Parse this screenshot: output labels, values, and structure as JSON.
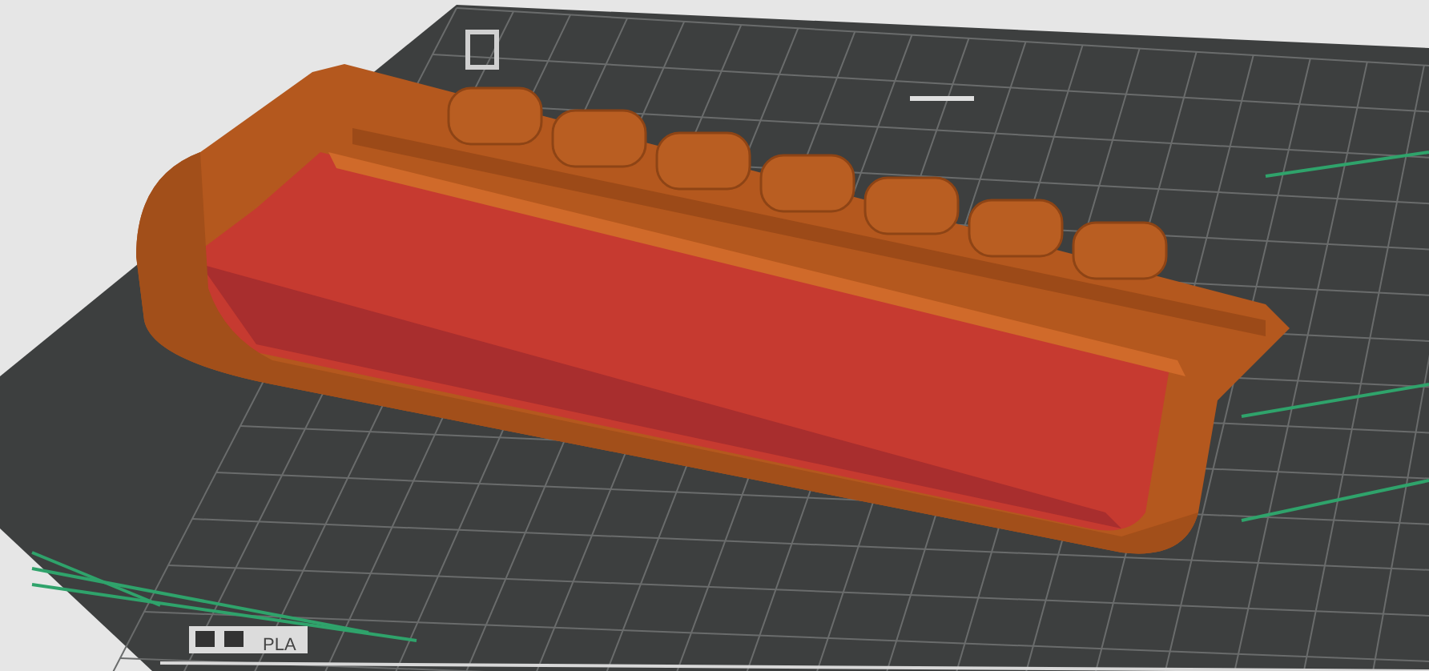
{
  "viewport": {
    "bed_label": "PLA"
  }
}
